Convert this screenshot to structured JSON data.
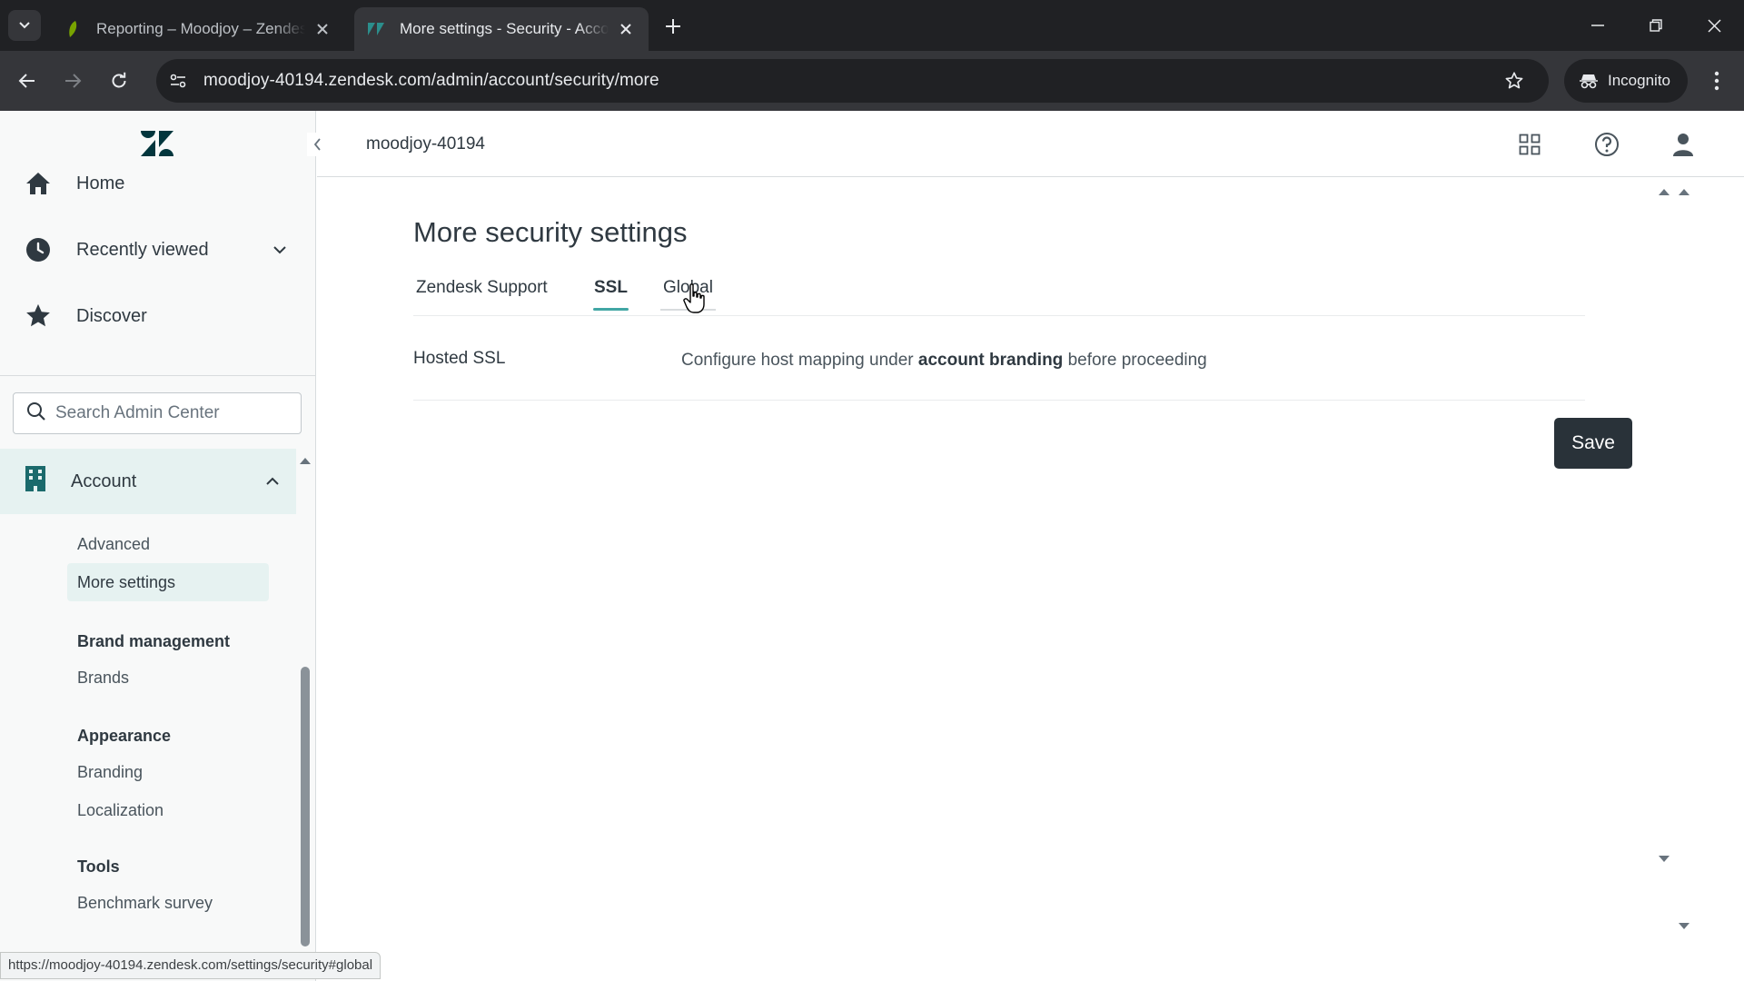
{
  "browser": {
    "tabs": [
      {
        "title": "Reporting – Moodjoy – Zendesk",
        "active": false,
        "icon": "explore-leaf-icon"
      },
      {
        "title": "More settings - Security - Account",
        "active": true,
        "icon": "zendesk-favicon"
      }
    ],
    "url": "moodjoy-40194.zendesk.com/admin/account/security/more",
    "incognito_label": "Incognito",
    "status_url": "https://moodjoy-40194.zendesk.com/settings/security#global"
  },
  "sidebar": {
    "nav": [
      {
        "label": "Home",
        "icon": "home-icon"
      },
      {
        "label": "Recently viewed",
        "icon": "clock-icon"
      },
      {
        "label": "Discover",
        "icon": "star-icon"
      }
    ],
    "search_placeholder": "Search Admin Center",
    "account_label": "Account",
    "account_items": [
      "Advanced",
      "More settings"
    ],
    "selected_item": "More settings",
    "groups": [
      {
        "heading": "Brand management",
        "items": [
          "Brands"
        ]
      },
      {
        "heading": "Appearance",
        "items": [
          "Branding",
          "Localization"
        ]
      },
      {
        "heading": "Tools",
        "items": [
          "Benchmark survey"
        ]
      }
    ]
  },
  "header": {
    "subdomain": "moodjoy-40194"
  },
  "main": {
    "title": "More security settings",
    "tabs": [
      "Zendesk Support",
      "SSL",
      "Global"
    ],
    "active_tab": "SSL",
    "hosted_ssl": {
      "label": "Hosted SSL",
      "desc_before": "Configure host mapping under ",
      "desc_bold": "account branding",
      "desc_after": " before proceeding"
    },
    "save_label": "Save"
  },
  "colors": {
    "accent": "#41a6a4",
    "brand": "#03363d",
    "save_button": "#293239"
  }
}
